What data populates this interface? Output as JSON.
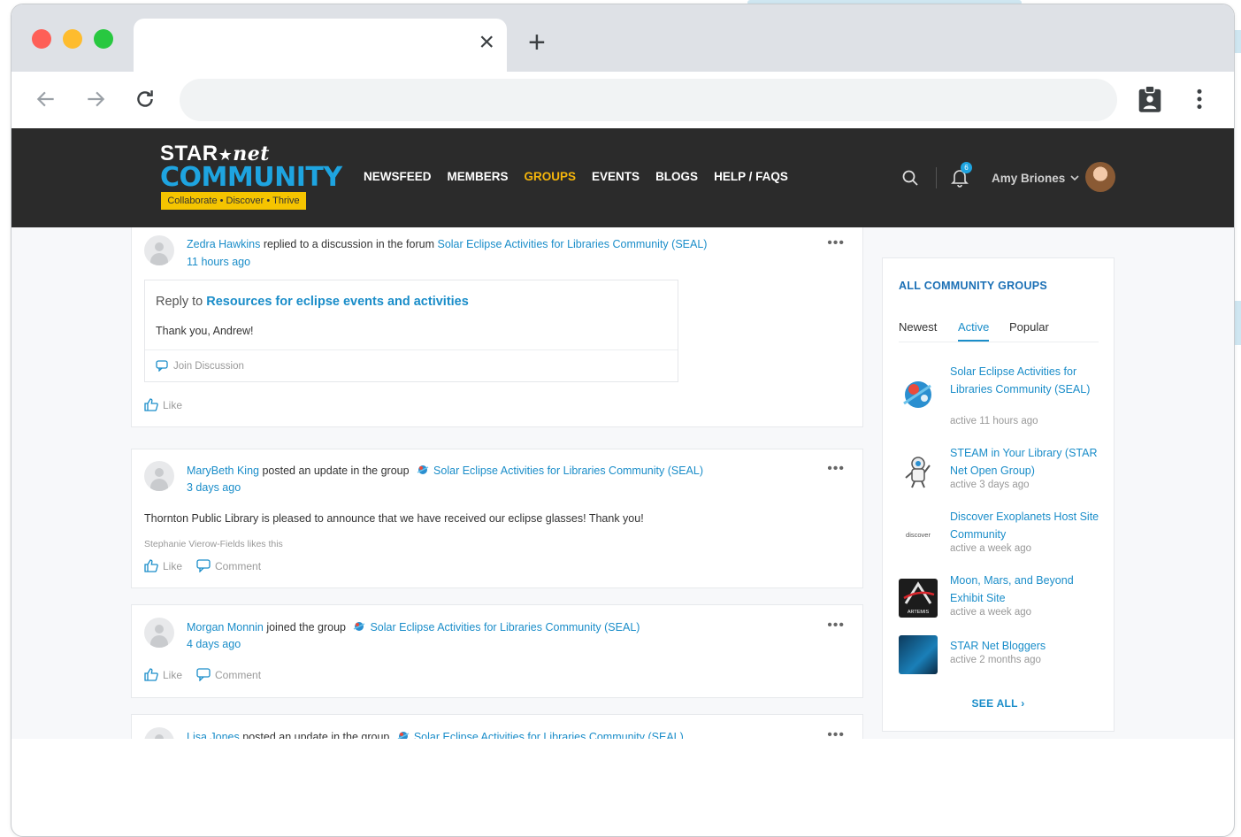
{
  "browser": {
    "tab_title": "",
    "tab_close": "×",
    "new_tab": "+",
    "address_value": "",
    "address_placeholder": ""
  },
  "site": {
    "logo": {
      "line1_star": "STAR",
      "line1_net": "net",
      "line2": "COMMUNITY",
      "tagline": "Collaborate • Discover • Thrive"
    },
    "nav": [
      "NEWSFEED",
      "MEMBERS",
      "GROUPS",
      "EVENTS",
      "BLOGS",
      "HELP / FAQS"
    ],
    "active_nav": "GROUPS",
    "notification_count": "6",
    "user_name": "Amy Briones"
  },
  "feed": [
    {
      "author": "Zedra Hawkins",
      "action": " replied to a discussion in the forum ",
      "target": "Solar Eclipse Activities for Libraries Community (SEAL)",
      "time": "11 hours ago",
      "reply_prefix": "Reply to ",
      "reply_link": "Resources for eclipse events and activities",
      "reply_body": "Thank you, Andrew!",
      "join_label": "Join Discussion",
      "like_label": "Like"
    },
    {
      "author": "MaryBeth King",
      "action": " posted an update in the group ",
      "target": "Solar Eclipse Activities for Libraries Community (SEAL)",
      "time": "3 days ago",
      "text": "Thornton Public Library is pleased to announce that we have received our eclipse glasses! Thank you!",
      "likes": "Stephanie Vierow-Fields likes this",
      "like_label": "Like",
      "comment_label": "Comment"
    },
    {
      "author": "Morgan Monnin",
      "action": " joined the group ",
      "target": "Solar Eclipse Activities for Libraries Community (SEAL)",
      "time": "4 days ago",
      "like_label": "Like",
      "comment_label": "Comment"
    },
    {
      "author": "Lisa Jones",
      "action": " posted an update in the group ",
      "target": "Solar Eclipse Activities for Libraries Community (SEAL)"
    }
  ],
  "sidebar": {
    "title": "ALL COMMUNITY GROUPS",
    "tabs": [
      "Newest",
      "Active",
      "Popular"
    ],
    "active_tab": "Active",
    "groups": [
      {
        "name": "Solar Eclipse Activities for Libraries Community (SEAL)",
        "activity": "active 11 hours ago"
      },
      {
        "name": "STEAM in Your Library (STAR Net Open Group)",
        "activity": "active 3 days ago"
      },
      {
        "name": "Discover Exoplanets Host Site Community",
        "activity": "active a week ago",
        "thumb_text": "discover"
      },
      {
        "name": "Moon, Mars, and Beyond Exhibit Site",
        "activity": "active a week ago",
        "thumb_text": "ARTEMIS"
      },
      {
        "name": "STAR Net Bloggers",
        "activity": "active 2 months ago"
      }
    ],
    "see_all": "SEE ALL"
  },
  "colors": {
    "header_bg": "#2b2b2b",
    "nav_active": "#f5b50b",
    "link": "#1a8dc9",
    "brand_blue": "#1ea4e0",
    "brand_yellow": "#f5c400"
  }
}
